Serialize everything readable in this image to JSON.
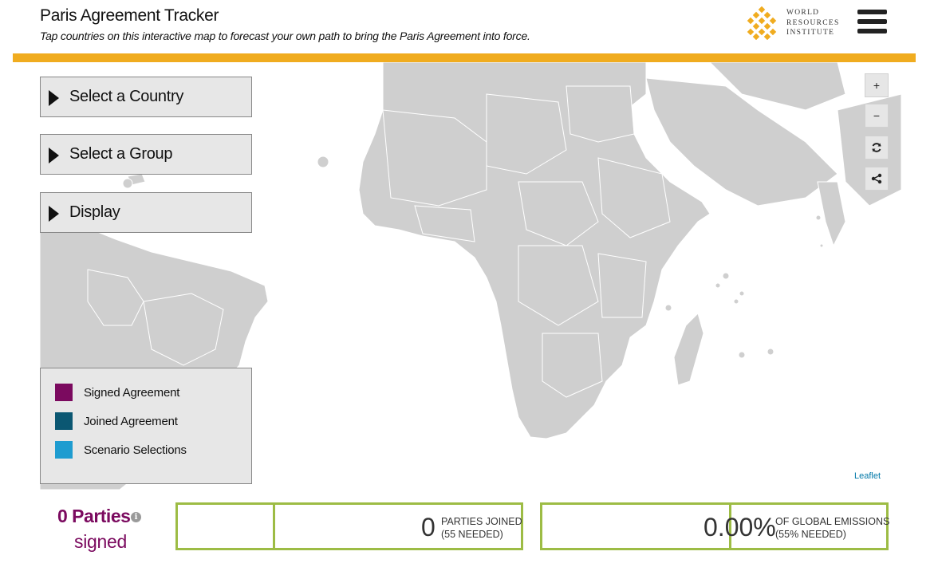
{
  "header": {
    "title": "Paris Agreement Tracker",
    "subtitle": "Tap countries on this interactive map to forecast your own path to bring the Paris Agreement into force.",
    "logo": {
      "line1": "WORLD",
      "line2": "RESOURCES",
      "line3": "INSTITUTE"
    },
    "menu_icon": "hamburger-menu-icon"
  },
  "panels": [
    {
      "label": "Select a Country"
    },
    {
      "label": "Select a Group"
    },
    {
      "label": "Display"
    }
  ],
  "legend": {
    "items": [
      {
        "label": "Signed Agreement",
        "color": "#7b0a5f"
      },
      {
        "label": "Joined Agreement",
        "color": "#0b5772"
      },
      {
        "label": "Scenario Selections",
        "color": "#1e9cd0"
      }
    ]
  },
  "map_controls": {
    "zoom_in": "+",
    "zoom_out": "−",
    "reset_icon": "refresh-icon",
    "share_icon": "share-icon",
    "attribution": "Leaflet"
  },
  "summary": {
    "parties_count": "0 Parties",
    "parties_suffix": "signed",
    "info_icon": "i"
  },
  "stats": {
    "parties_joined": {
      "value": "0",
      "label_line1": "PARTIES JOINED",
      "label_line2": "(55 NEEDED)"
    },
    "global_emissions": {
      "value": "0.00%",
      "label_line1": "OF GLOBAL EMISSIONS",
      "label_line2": "(55% NEEDED)"
    }
  },
  "colors": {
    "accent_gold": "#f0ac1f",
    "stat_border_green": "#9dbc45",
    "signed_purple": "#7b0a5f",
    "land_gray": "#cfcfcf"
  }
}
